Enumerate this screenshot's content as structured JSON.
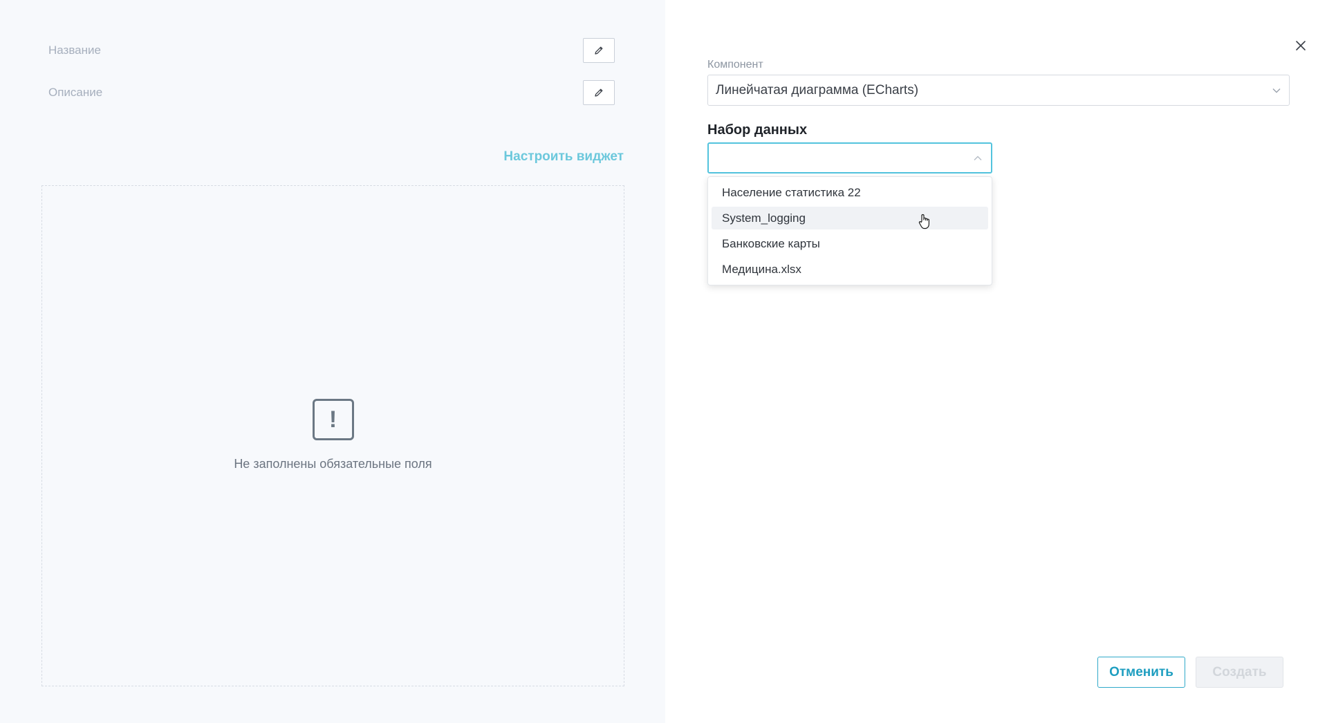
{
  "preview": {
    "title_label": "Название",
    "description_label": "Описание",
    "configure_link": "Настроить виджет",
    "empty_state": {
      "icon": "exclamation-square-icon",
      "message": "Не заполнены обязательные поля"
    }
  },
  "settings": {
    "component_label": "Компонент",
    "component_value": "Линейчатая диаграмма (ECharts)",
    "dataset_title": "Набор данных",
    "dataset_value": "",
    "dataset_options": [
      "Население статистика 22",
      "System_logging",
      "Банковские карты",
      "Медицина.xlsx"
    ],
    "hovered_option": "System_logging"
  },
  "actions": {
    "cancel_label": "Отменить",
    "create_label": "Создать"
  },
  "colors": {
    "accent": "#52c3dd",
    "link": "#6cc8dc",
    "primary_text": "#1f2329",
    "muted_text": "#a6afbd",
    "preview_bg": "#f7f9fc"
  }
}
